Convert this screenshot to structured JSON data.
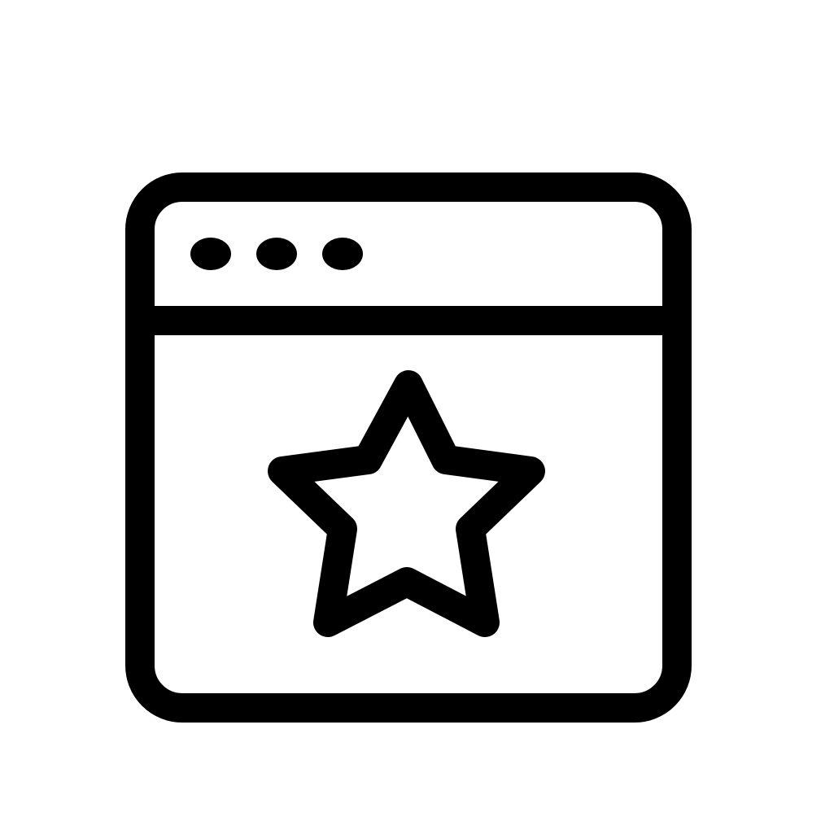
{
  "icon": {
    "name": "browser-window-star-icon",
    "stroke_color": "#000000",
    "background_color": "#ffffff",
    "parts": {
      "window": "browser-window-outline",
      "dots": [
        "window-dot",
        "window-dot",
        "window-dot"
      ],
      "divider": "title-bar-divider",
      "star": "star-icon"
    }
  }
}
